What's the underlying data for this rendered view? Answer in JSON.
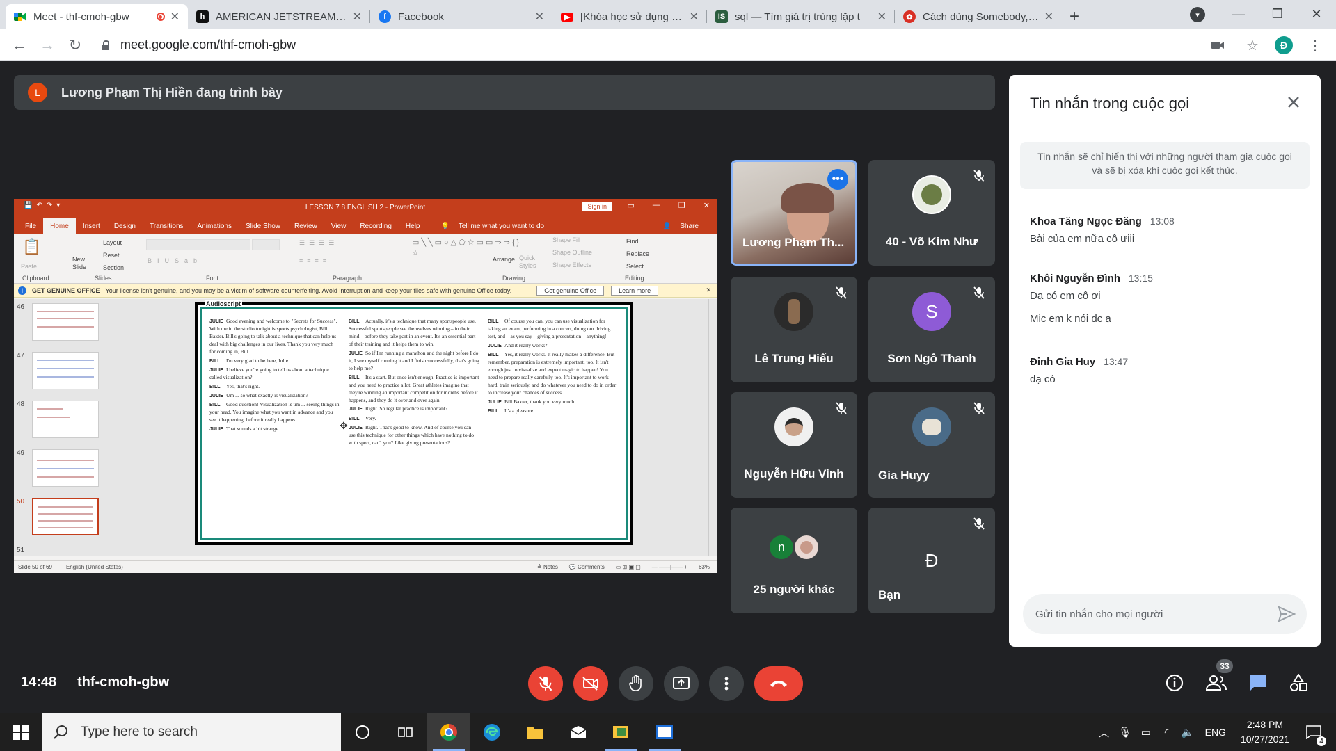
{
  "browser": {
    "tabs": [
      {
        "title": "Meet - thf-cmoh-gbw",
        "active": true,
        "icon": "meet-icon",
        "recording": true
      },
      {
        "title": "AMERICAN JETSTREAM Pre",
        "icon": "jetstream-icon"
      },
      {
        "title": "Facebook",
        "icon": "facebook-icon"
      },
      {
        "title": "[Khóa học sử dụng SQL ser",
        "icon": "youtube-icon"
      },
      {
        "title": "sql — Tìm giá trị trùng lặp t",
        "icon": "sql-site-icon"
      },
      {
        "title": "Cách dùng Somebody, som",
        "icon": "web-icon"
      }
    ],
    "url": "meet.google.com/thf-cmoh-gbw",
    "profile_initial": "Đ"
  },
  "meet": {
    "presenter_initial": "L",
    "presenter_banner": "Lương Phạm Thị Hiền đang trình bày",
    "meeting_time": "14:48",
    "meeting_code": "thf-cmoh-gbw",
    "participant_count": "33",
    "tiles": [
      {
        "name": "Lương Phạm Th...",
        "video": true
      },
      {
        "name": "40 - Võ Kim Như"
      },
      {
        "name": "Lê Trung Hiếu"
      },
      {
        "name": "Sơn Ngô Thanh",
        "initial": "S",
        "color": "#8e5bd6"
      },
      {
        "name": "Nguyễn Hữu Vinh"
      },
      {
        "name": "Gia Huyy"
      },
      {
        "name": "25 người khác",
        "initial": "n"
      },
      {
        "name": "Bạn",
        "initial": "Đ",
        "color": "#0f9d8e"
      }
    ]
  },
  "chat": {
    "title": "Tin nhắn trong cuộc gọi",
    "notice": "Tin nhắn sẽ chỉ hiển thị với những người tham gia cuộc gọi và sẽ bị xóa khi cuộc gọi kết thúc.",
    "messages": [
      {
        "sender": "Khoa Tăng Ngọc Đăng",
        "time": "13:08",
        "lines": [
          "Bài của em nữa cô ưiii"
        ]
      },
      {
        "sender": "Khôi Nguyễn Đình",
        "time": "13:15",
        "lines": [
          "Dạ có em cô ơi",
          "Mic em k nói dc ạ"
        ]
      },
      {
        "sender": "Đinh Gia Huy",
        "time": "13:47",
        "lines": [
          "dạ có"
        ]
      }
    ],
    "input_placeholder": "Gửi tin nhắn cho mọi người"
  },
  "powerpoint": {
    "title": "LESSON 7 8   ENGLISH 2  -  PowerPoint",
    "sign_in": "Sign in",
    "menu": [
      "File",
      "Home",
      "Insert",
      "Design",
      "Transitions",
      "Animations",
      "Slide Show",
      "Review",
      "View",
      "Recording",
      "Help"
    ],
    "tell_me": "Tell me what you want to do",
    "share": "Share",
    "ribbon_groups": [
      "Clipboard",
      "Slides",
      "Font",
      "Paragraph",
      "Drawing",
      "Editing"
    ],
    "ribbon_labels": {
      "paste": "Paste",
      "new_slide": "New Slide",
      "layout": "Layout",
      "reset": "Reset",
      "section": "Section",
      "arrange": "Arrange",
      "quick_styles": "Quick Styles",
      "shape_fill": "Shape Fill",
      "shape_outline": "Shape Outline",
      "shape_effects": "Shape Effects",
      "find": "Find",
      "replace": "Replace",
      "select": "Select"
    },
    "warning": {
      "label": "GET GENUINE OFFICE",
      "text": "Your license isn't genuine, and you may be a victim of software counterfeiting. Avoid interruption and keep your files safe with genuine Office today.",
      "button": "Get genuine Office",
      "learn": "Learn more"
    },
    "slide_numbers": [
      "46",
      "47",
      "48",
      "49",
      "50",
      "51"
    ],
    "status": {
      "slide": "Slide 50 of 69",
      "language": "English (United States)",
      "notes": "Notes",
      "comments": "Comments",
      "zoom": "63%"
    },
    "transcript_heading": "Audioscript",
    "transcript": [
      [
        {
          "speaker": "JULIE",
          "text": "Good evening and welcome to \"Secrets for Success\". With me in the studio tonight is sports psychologist, Bill Baxter. Bill's going to talk about a technique that can help us deal with big challenges in our lives. Thank you very much for coming in, Bill."
        },
        {
          "speaker": "BILL",
          "text": "I'm very glad to be here, Julie."
        },
        {
          "speaker": "JULIE",
          "text": "I believe you're going to tell us about a technique called visualization?"
        },
        {
          "speaker": "BILL",
          "text": "Yes, that's right."
        },
        {
          "speaker": "JULIE",
          "text": "Um ... so what exactly is visualization?"
        },
        {
          "speaker": "BILL",
          "text": "Good question! Visualization is um ... seeing things in your head. You imagine what you want in advance and you see it happening, before it really happens."
        },
        {
          "speaker": "JULIE",
          "text": "That sounds a bit strange."
        }
      ],
      [
        {
          "speaker": "BILL",
          "text": "Actually, it's a technique that many sportspeople use. Successful sportspeople see themselves winning – in their mind – before they take part in an event. It's an essential part of their training and it helps them to win."
        },
        {
          "speaker": "JULIE",
          "text": "So if I'm running a marathon and the night before I do it, I see myself running it and I finish successfully, that's going to help me?"
        },
        {
          "speaker": "BILL",
          "text": "It's a start. But once isn't enough. Practice is important and you need to practice a lot. Great athletes imagine that they're winning an important competition for months before it happens, and they do it over and over again."
        },
        {
          "speaker": "JULIE",
          "text": "Right. So regular practice is important?"
        },
        {
          "speaker": "BILL",
          "text": "Very."
        },
        {
          "speaker": "JULIE",
          "text": "Right. That's good to know. And of course you can use this technique for other things which have nothing to do with sport, can't you? Like giving presentations?"
        }
      ],
      [
        {
          "speaker": "BILL",
          "text": "Of course you can, you can use visualization for taking an exam, performing in a concert, doing our driving test, and – as you say – giving a presentation – anything!"
        },
        {
          "speaker": "JULIE",
          "text": "And it really works?"
        },
        {
          "speaker": "BILL",
          "text": "Yes, it really works. It really makes a difference. But remember, preparation is extremely important, too. It isn't enough just to visualize and expect magic to happen! You need to prepare really carefully too. It's important to work hard, train seriously, and do whatever you need to do in order to increase your chances of success."
        },
        {
          "speaker": "JULIE",
          "text": "Bill Baxter, thank you very much."
        },
        {
          "speaker": "BILL",
          "text": "It's a pleasure."
        }
      ]
    ]
  },
  "taskbar": {
    "search_placeholder": "Type here to search",
    "language": "ENG",
    "time": "2:48 PM",
    "date": "10/27/2021",
    "notification_count": "4"
  },
  "colors": {
    "meet_bg": "#202124",
    "tile_bg": "#3c4043",
    "danger": "#ea4335",
    "ppt_accent": "#c43e1c",
    "meet_blue": "#1a73e8"
  }
}
